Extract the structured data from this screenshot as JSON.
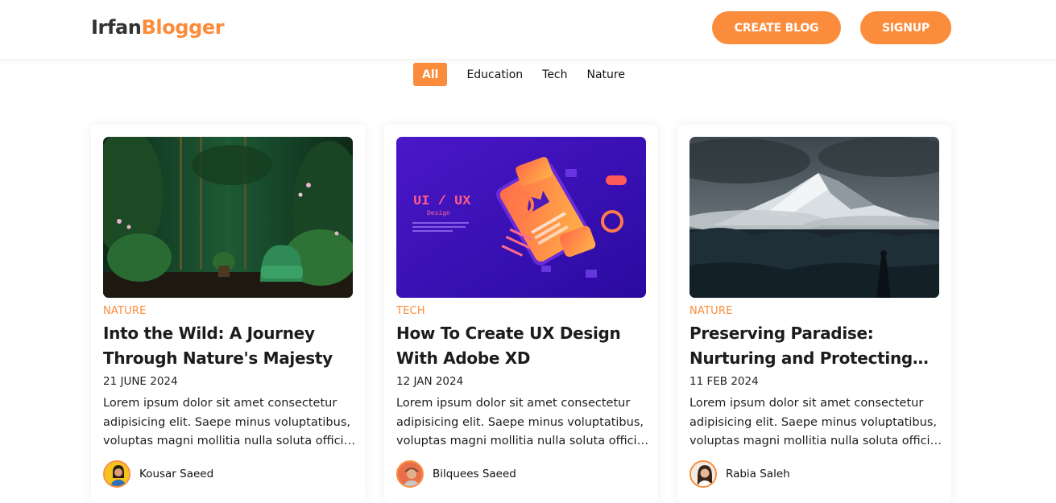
{
  "header": {
    "logo_part1": "Irfan",
    "logo_part2": "Blogger",
    "create_label": "CREATE BLOG",
    "signup_label": "SIGNUP",
    "accent_color": "#fb8c3c"
  },
  "filters": {
    "items": [
      "All",
      "Education",
      "Tech",
      "Nature"
    ],
    "active": "All"
  },
  "posts": [
    {
      "category": "NATURE",
      "title": "Into the Wild: A Journey Through Nature's Majesty",
      "date": "21 JUNE 2024",
      "excerpt": "Lorem ipsum dolor sit amet consectetur adipisicing elit. Saepe minus voluptatibus, voluptas magni mollitia nulla soluta officiis dolore.",
      "author": "Kousar Saeed",
      "image": "green-jungle-room-with-armchair"
    },
    {
      "category": "TECH",
      "title": "How To Create UX Design With Adobe XD",
      "date": "12 JAN 2024",
      "excerpt": "Lorem ipsum dolor sit amet consectetur adipisicing elit. Saepe minus voluptatibus, voluptas magni mollitia nulla soluta officiis dolore.",
      "author": "Bilquees Saeed",
      "image": "ui-ux-design-isometric-illustration",
      "image_text": "UI / UX",
      "image_subtext": "Design"
    },
    {
      "category": "NATURE",
      "title": "Preserving Paradise: Nurturing and Protecting Our Planet",
      "date": "11 FEB 2024",
      "excerpt": "Lorem ipsum dolor sit amet consectetur adipisicing elit. Saepe minus voluptatibus, voluptas magni mollitia nulla soluta officiis dolore.",
      "author": "Rabia Saleh",
      "image": "snowy-mountain-under-stormy-clouds"
    }
  ]
}
